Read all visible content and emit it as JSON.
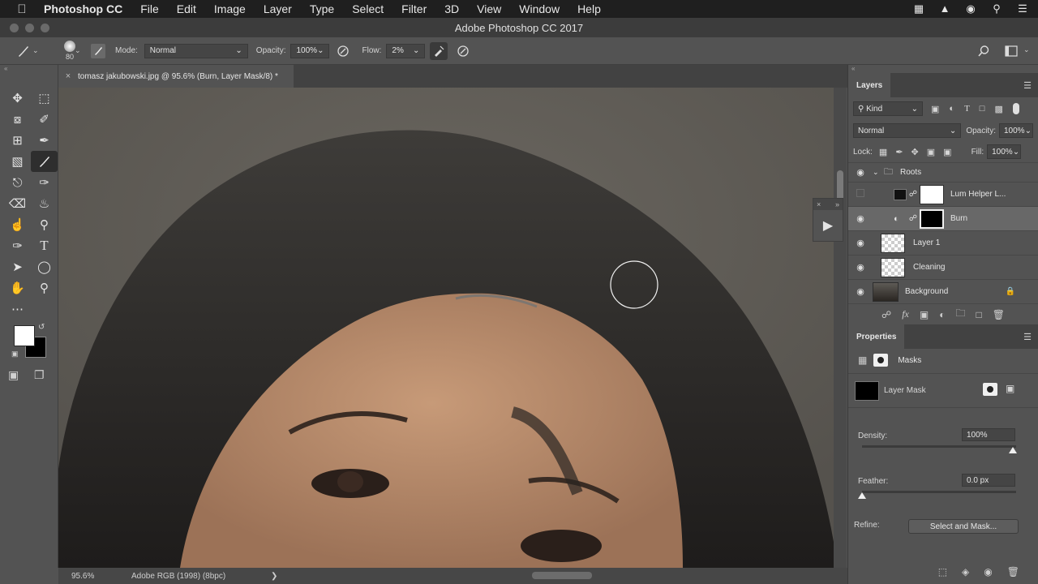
{
  "menubar": {
    "app": "Photoshop CC",
    "items": [
      "File",
      "Edit",
      "Image",
      "Layer",
      "Type",
      "Select",
      "Filter",
      "3D",
      "View",
      "Window",
      "Help"
    ]
  },
  "titlebar": {
    "title": "Adobe Photoshop CC 2017"
  },
  "options": {
    "brush_size": "80",
    "mode_label": "Mode:",
    "mode_value": "Normal",
    "opacity_label": "Opacity:",
    "opacity_value": "100%",
    "flow_label": "Flow:",
    "flow_value": "2%"
  },
  "document": {
    "tab_title": "tomasz jakubowski.jpg @ 95.6% (Burn, Layer Mask/8) *"
  },
  "status": {
    "zoom": "95.6%",
    "profile": "Adobe RGB (1998) (8bpc)",
    "arrow": "❯"
  },
  "layers_panel": {
    "tab": "Layers",
    "filter_kind": "Kind",
    "blend_mode": "Normal",
    "opacity_label": "Opacity:",
    "opacity_value": "100%",
    "lock_label": "Lock:",
    "fill_label": "Fill:",
    "fill_value": "100%",
    "layers": [
      {
        "name": "Roots",
        "type": "group",
        "visible": true
      },
      {
        "name": "Lum Helper L...",
        "type": "masked",
        "visible": false
      },
      {
        "name": "Burn",
        "type": "adjustment",
        "visible": true,
        "selected": true
      },
      {
        "name": "Layer 1",
        "type": "pixel",
        "visible": true
      },
      {
        "name": "Cleaning",
        "type": "pixel",
        "visible": true
      },
      {
        "name": "Background",
        "type": "background",
        "visible": true,
        "locked": true
      }
    ]
  },
  "properties_panel": {
    "tab": "Properties",
    "section": "Masks",
    "mask_label": "Layer Mask",
    "density_label": "Density:",
    "density_value": "100%",
    "density_level": 1.0,
    "feather_label": "Feather:",
    "feather_value": "0.0 px",
    "feather_level": 0.0,
    "refine_label": "Refine:",
    "refine_button": "Select and Mask..."
  },
  "colors": {
    "foreground": "#ffffff",
    "background": "#000000",
    "ui_bg": "#535353",
    "panel_dark": "#424242"
  }
}
